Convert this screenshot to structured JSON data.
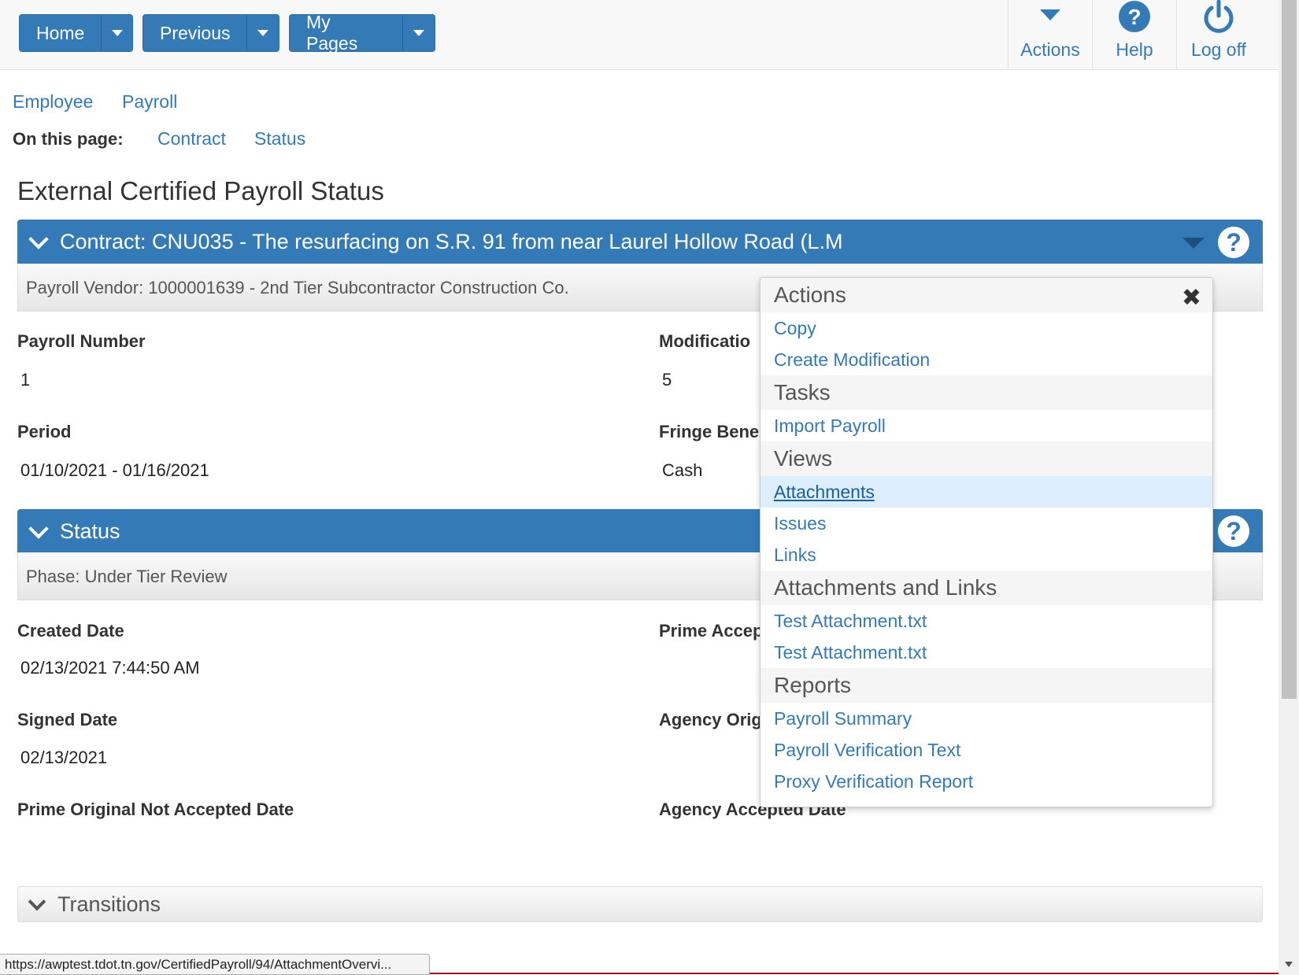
{
  "nav": {
    "home": "Home",
    "previous": "Previous",
    "my_pages": "My Pages",
    "actions": "Actions",
    "help": "Help",
    "logoff": "Log off"
  },
  "breadcrumb": {
    "employee": "Employee",
    "payroll": "Payroll",
    "on_this_page": "On this page:",
    "contract": "Contract",
    "status": "Status"
  },
  "page_title": "External Certified Payroll Status",
  "contract_panel": {
    "title": "Contract: CNU035 - The resurfacing on S.R. 91 from near Laurel Hollow Road (L.M",
    "vendor": "Payroll Vendor: 1000001639 - 2nd Tier Subcontractor Construction Co."
  },
  "fields": {
    "payroll_number_label": "Payroll Number",
    "payroll_number": "1",
    "modification_label": "Modificatio",
    "modification": "5",
    "period_label": "Period",
    "period": "01/10/2021 - 01/16/2021",
    "fringe_label": "Fringe Bene",
    "fringe": "Cash"
  },
  "status_panel": {
    "title": "Status",
    "phase": "Phase: Under Tier Review"
  },
  "status_fields": {
    "created_label": "Created Date",
    "created": "02/13/2021 7:44:50 AM",
    "prime_accepted_label": "Prime Accep",
    "signed_label": "Signed Date",
    "signed": "02/13/2021",
    "agency_original_label": "Agency Orig",
    "prime_not_accepted_label": "Prime Original Not Accepted Date",
    "agency_accepted_label": "Agency Accepted Date"
  },
  "transitions": "Transitions",
  "status_url": "https://awptest.tdot.tn.gov/CertifiedPayroll/94/AttachmentOvervi...",
  "dropdown": {
    "close": "✖",
    "actions_header": "Actions",
    "copy": "Copy",
    "create_modification": "Create Modification",
    "tasks_header": "Tasks",
    "import_payroll": "Import Payroll",
    "views_header": "Views",
    "attachments": "Attachments",
    "issues": "Issues",
    "links": "Links",
    "attachments_links_header": "Attachments and Links",
    "attachment1": "Test Attachment.txt",
    "attachment2": "Test Attachment.txt",
    "reports_header": "Reports",
    "payroll_summary": "Payroll Summary",
    "payroll_verification": "Payroll Verification Text",
    "proxy_verification": "Proxy Verification Report"
  },
  "colors": {
    "primary": "#337ab7",
    "highlight": "#ddeeff"
  }
}
